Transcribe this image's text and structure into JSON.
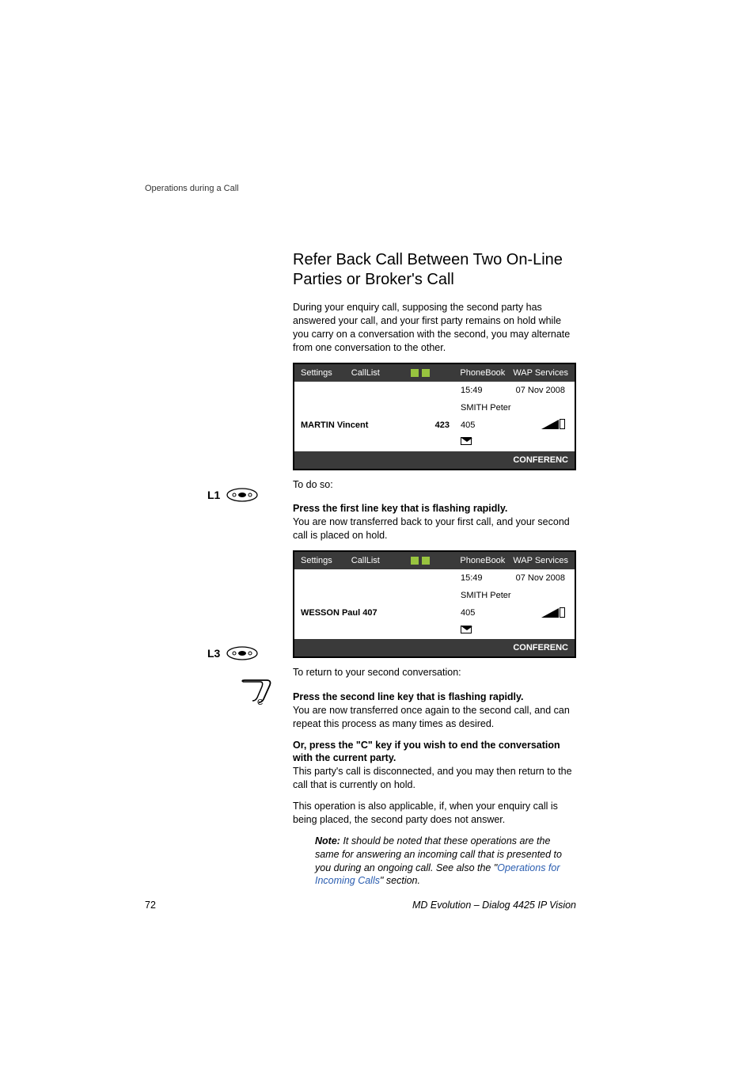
{
  "header": {
    "section": "Operations during a Call"
  },
  "heading": "Refer Back Call Between Two On-Line Parties or Broker's Call",
  "intro": "During your enquiry call, supposing the second party has answered your call, and your first party remains on hold while you carry on a conversation with the second, you may alternate from one conversation to the other.",
  "todo": "To do so:",
  "l1": {
    "label": "L1",
    "title": "Press the first line key that is flashing rapidly.",
    "body": "You are now transferred back to your first call, and your second call is placed on hold."
  },
  "return_text": "To return to your second conversation:",
  "l3": {
    "label": "L3",
    "title": "Press the second line key that is flashing rapidly.",
    "body": "You are now transferred once again to the second call, and can repeat this process as many times as desired."
  },
  "ckey": {
    "title": "Or, press the \"C\" key if you wish to end the conversation with the current party.",
    "body": "This party's call is disconnected, and you may then return to the call that is currently on hold.",
    "extra": "This operation is also applicable, if, when your enquiry call is being placed, the second party does not answer."
  },
  "note": {
    "label": "Note:",
    "body_pre": "It should be noted that these operations are the same for answering an incoming call that is presented to you during an ongoing call. See also the \"",
    "link": "Operations for Incoming Calls",
    "body_post": "\" section."
  },
  "screen1": {
    "menu": {
      "settings": "Settings",
      "calllist": "CallList",
      "phonebook": "PhoneBook",
      "wap": "WAP Services"
    },
    "time": "15:49",
    "date": "07 Nov 2008",
    "owner": "SMITH Peter",
    "caller_name": "MARTIN Vincent",
    "caller_num": "423",
    "ext": "405",
    "softkey": "CONFERENC"
  },
  "screen2": {
    "menu": {
      "settings": "Settings",
      "calllist": "CallList",
      "phonebook": "PhoneBook",
      "wap": "WAP Services"
    },
    "time": "15:49",
    "date": "07 Nov 2008",
    "owner": "SMITH Peter",
    "caller_name": "WESSON Paul 407",
    "caller_num": "",
    "ext": "405",
    "softkey": "CONFERENC"
  },
  "footer": {
    "page": "72",
    "title": "MD Evolution – Dialog 4425 IP Vision"
  }
}
